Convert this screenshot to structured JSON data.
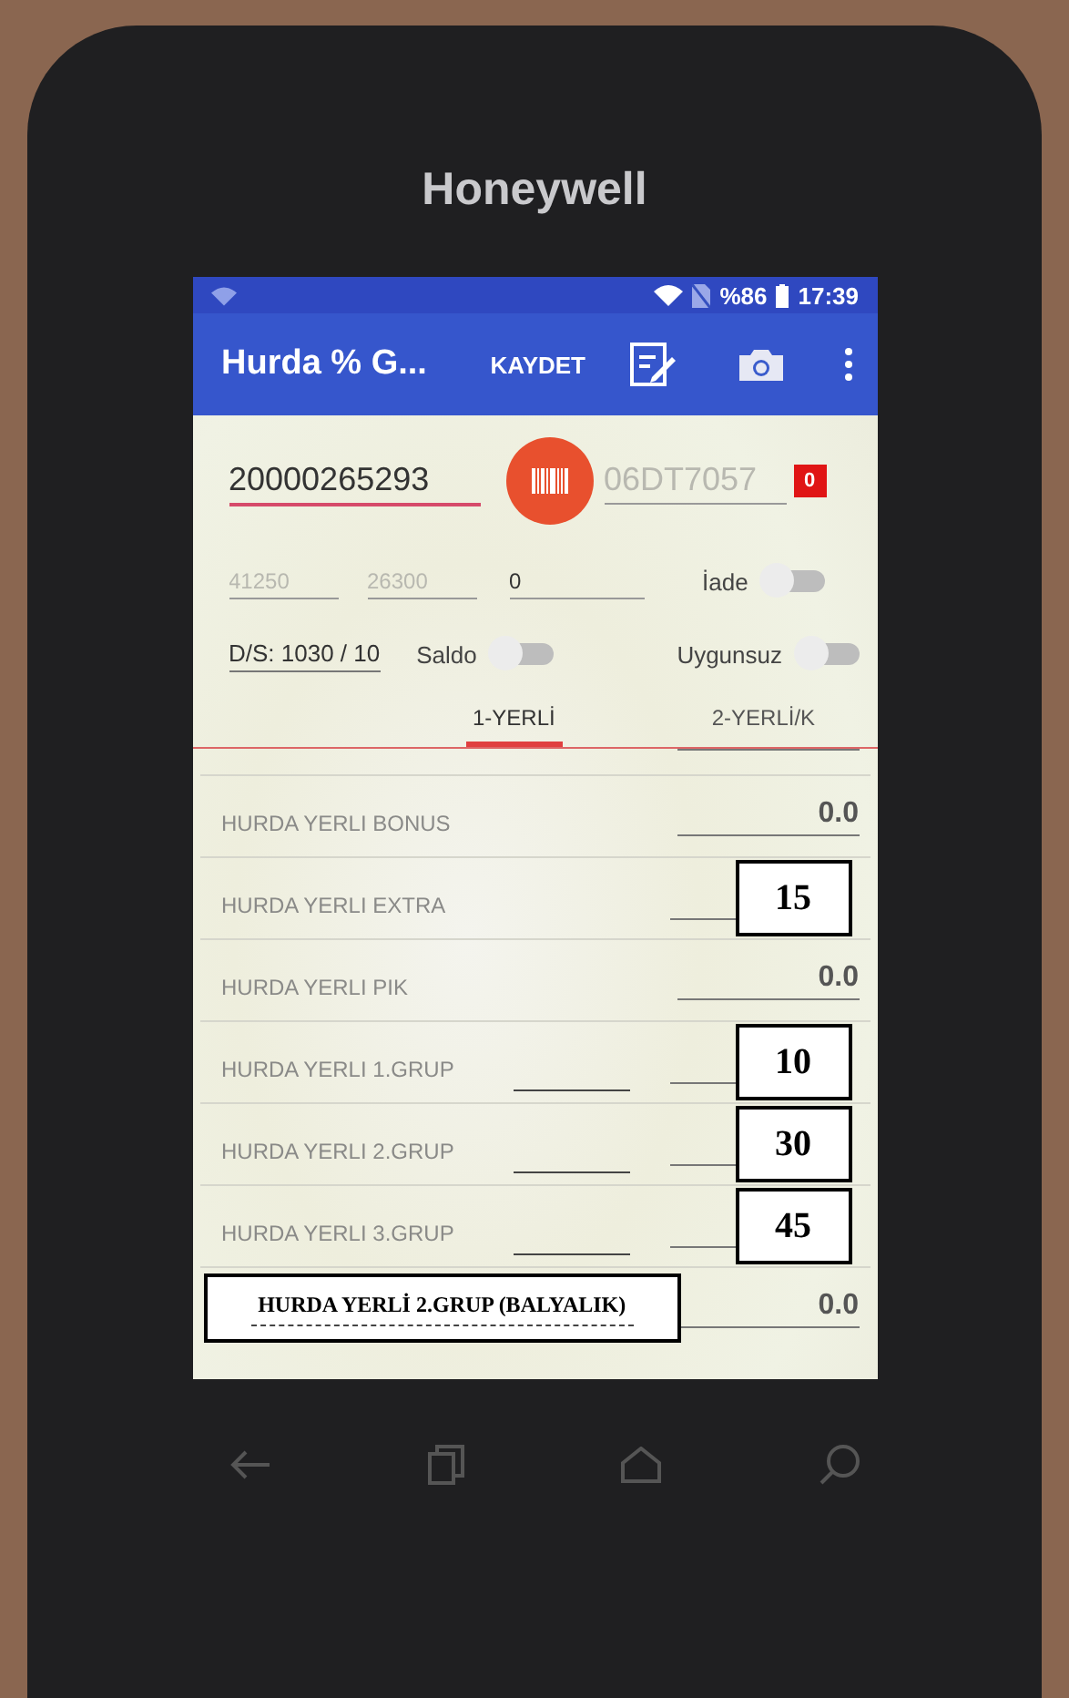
{
  "phone": {
    "brand": "Honeywell"
  },
  "status_bar": {
    "battery": "%86",
    "time": "17:39"
  },
  "app_bar": {
    "title": "Hurda % G...",
    "action": "KAYDET"
  },
  "form": {
    "barcode_field": {
      "value": "20000265293",
      "focused": true
    },
    "plate_field": {
      "placeholder": "06DT7057"
    },
    "count_badge": "0",
    "weights": [
      {
        "value": "41250",
        "disabled": true
      },
      {
        "value": "26300",
        "disabled": true
      },
      {
        "value": "0",
        "disabled": false
      }
    ],
    "ds_label": "D/S: 1030 / 10",
    "toggles": [
      {
        "label": "İade",
        "on": false
      },
      {
        "label": "Saldo",
        "on": false
      },
      {
        "label": "Uygunsuz",
        "on": false
      }
    ]
  },
  "tabs": [
    {
      "label": "1-YERLİ",
      "selected": true
    },
    {
      "label": "2-YERLİ/K",
      "selected": false
    }
  ],
  "rows": [
    {
      "label": "HURDA YERLI BONUS",
      "value": "0.0",
      "kind": "plain",
      "second_field": false
    },
    {
      "label": "HURDA YERLI EXTRA",
      "value": "15",
      "kind": "annotated",
      "second_field": false
    },
    {
      "label": "HURDA YERLI PIK",
      "value": "0.0",
      "kind": "plain",
      "second_field": false
    },
    {
      "label": "HURDA YERLI 1.GRUP",
      "value": "10",
      "kind": "annotated",
      "second_field": true
    },
    {
      "label": "HURDA YERLI 2.GRUP",
      "value": "30",
      "kind": "annotated",
      "second_field": true
    },
    {
      "label": "HURDA YERLI 3.GRUP",
      "value": "45",
      "kind": "annotated",
      "second_field": true
    }
  ],
  "note_row": {
    "note": "HURDA YERLİ 2.GRUP (BALYALIK)",
    "value": "0.0"
  }
}
